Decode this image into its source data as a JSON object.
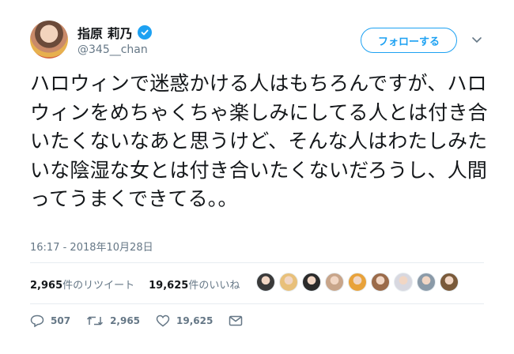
{
  "user": {
    "display_name": "指原 莉乃",
    "handle": "@345__chan"
  },
  "follow_button": "フォローする",
  "tweet": {
    "text": "ハロウィンで迷惑かける人はもちろんですが、ハロウィンをめちゃくちゃ楽しみにしてる人とは付き合いたくないなあと思うけど、そんな人はわたしみたいな陰湿な女とは付き合いたくないだろうし、人間ってうまくできてる。。",
    "timestamp": "16:17 - 2018年10月28日"
  },
  "stats": {
    "retweets_count": "2,965",
    "retweets_label": "件のリツイート",
    "likes_count": "19,625",
    "likes_label": "件のいいね"
  },
  "actions": {
    "replies": "507",
    "retweets": "2,965",
    "likes": "19,625"
  },
  "colors": {
    "accent": "#1da1f2",
    "secondary_text": "#657786",
    "divider": "#e6ecf0"
  },
  "liker_avatars": [
    "#3a3a3a",
    "#e8c07a",
    "#2b2b2b",
    "#c8a58a",
    "#e8a23a",
    "#9b6b4a",
    "#d8d8e0",
    "#8a9aa8",
    "#7a5a3a"
  ]
}
